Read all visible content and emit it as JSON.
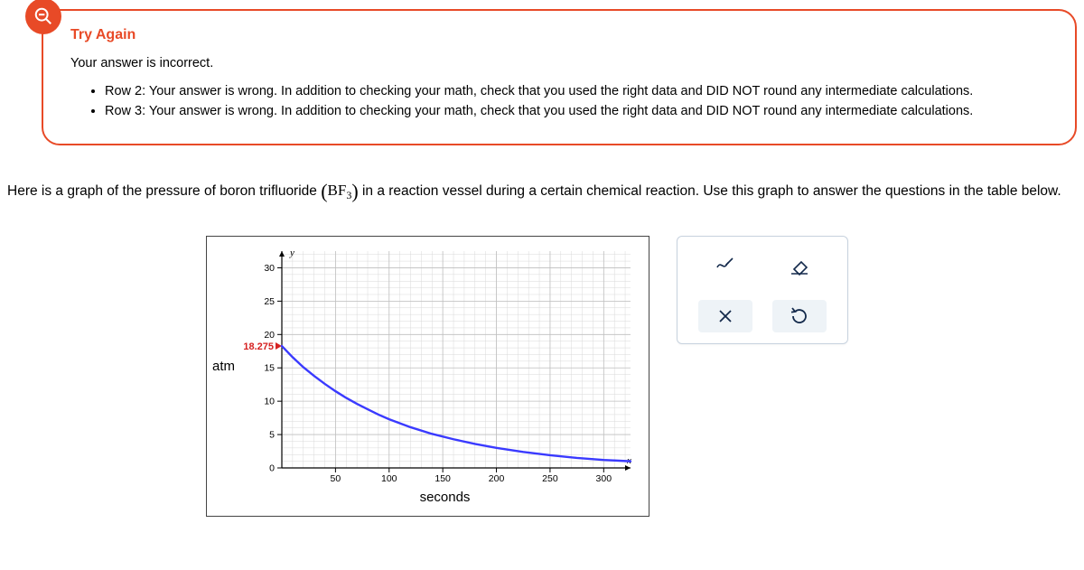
{
  "feedback": {
    "title": "Try Again",
    "subtitle": "Your answer is incorrect.",
    "items": [
      "Row 2: Your answer is wrong. In addition to checking your math, check that you used the right data and DID NOT round any intermediate calculations.",
      "Row 3: Your answer is wrong. In addition to checking your math, check that you used the right data and DID NOT round any intermediate calculations."
    ]
  },
  "question": {
    "prefix": "Here is a graph of the pressure of boron trifluoride ",
    "formula": {
      "base": "BF",
      "sub": "3"
    },
    "suffix": " in a reaction vessel during a certain chemical reaction. Use this graph to answer the questions in the table below."
  },
  "chart_data": {
    "type": "line",
    "title": "",
    "xlabel": "seconds",
    "ylabel": "atm",
    "xlim": [
      0,
      325
    ],
    "ylim": [
      0,
      32.5
    ],
    "xticks": [
      50,
      100,
      150,
      200,
      250,
      300
    ],
    "yticks": [
      0,
      5,
      10,
      15,
      20,
      25,
      30
    ],
    "annotation": {
      "x": 0,
      "y": 18.275,
      "label": "18.275"
    },
    "series": [
      {
        "name": "BF3 pressure",
        "color": "#3a3aff",
        "x": [
          0,
          10,
          20,
          30,
          40,
          50,
          60,
          70,
          80,
          90,
          100,
          120,
          140,
          160,
          180,
          200,
          225,
          250,
          275,
          300,
          325
        ],
        "values": [
          18.275,
          16.6,
          15.1,
          13.8,
          12.6,
          11.5,
          10.5,
          9.6,
          8.8,
          8.0,
          7.3,
          6.1,
          5.1,
          4.3,
          3.6,
          3.0,
          2.4,
          1.9,
          1.5,
          1.2,
          1.0
        ]
      }
    ]
  }
}
